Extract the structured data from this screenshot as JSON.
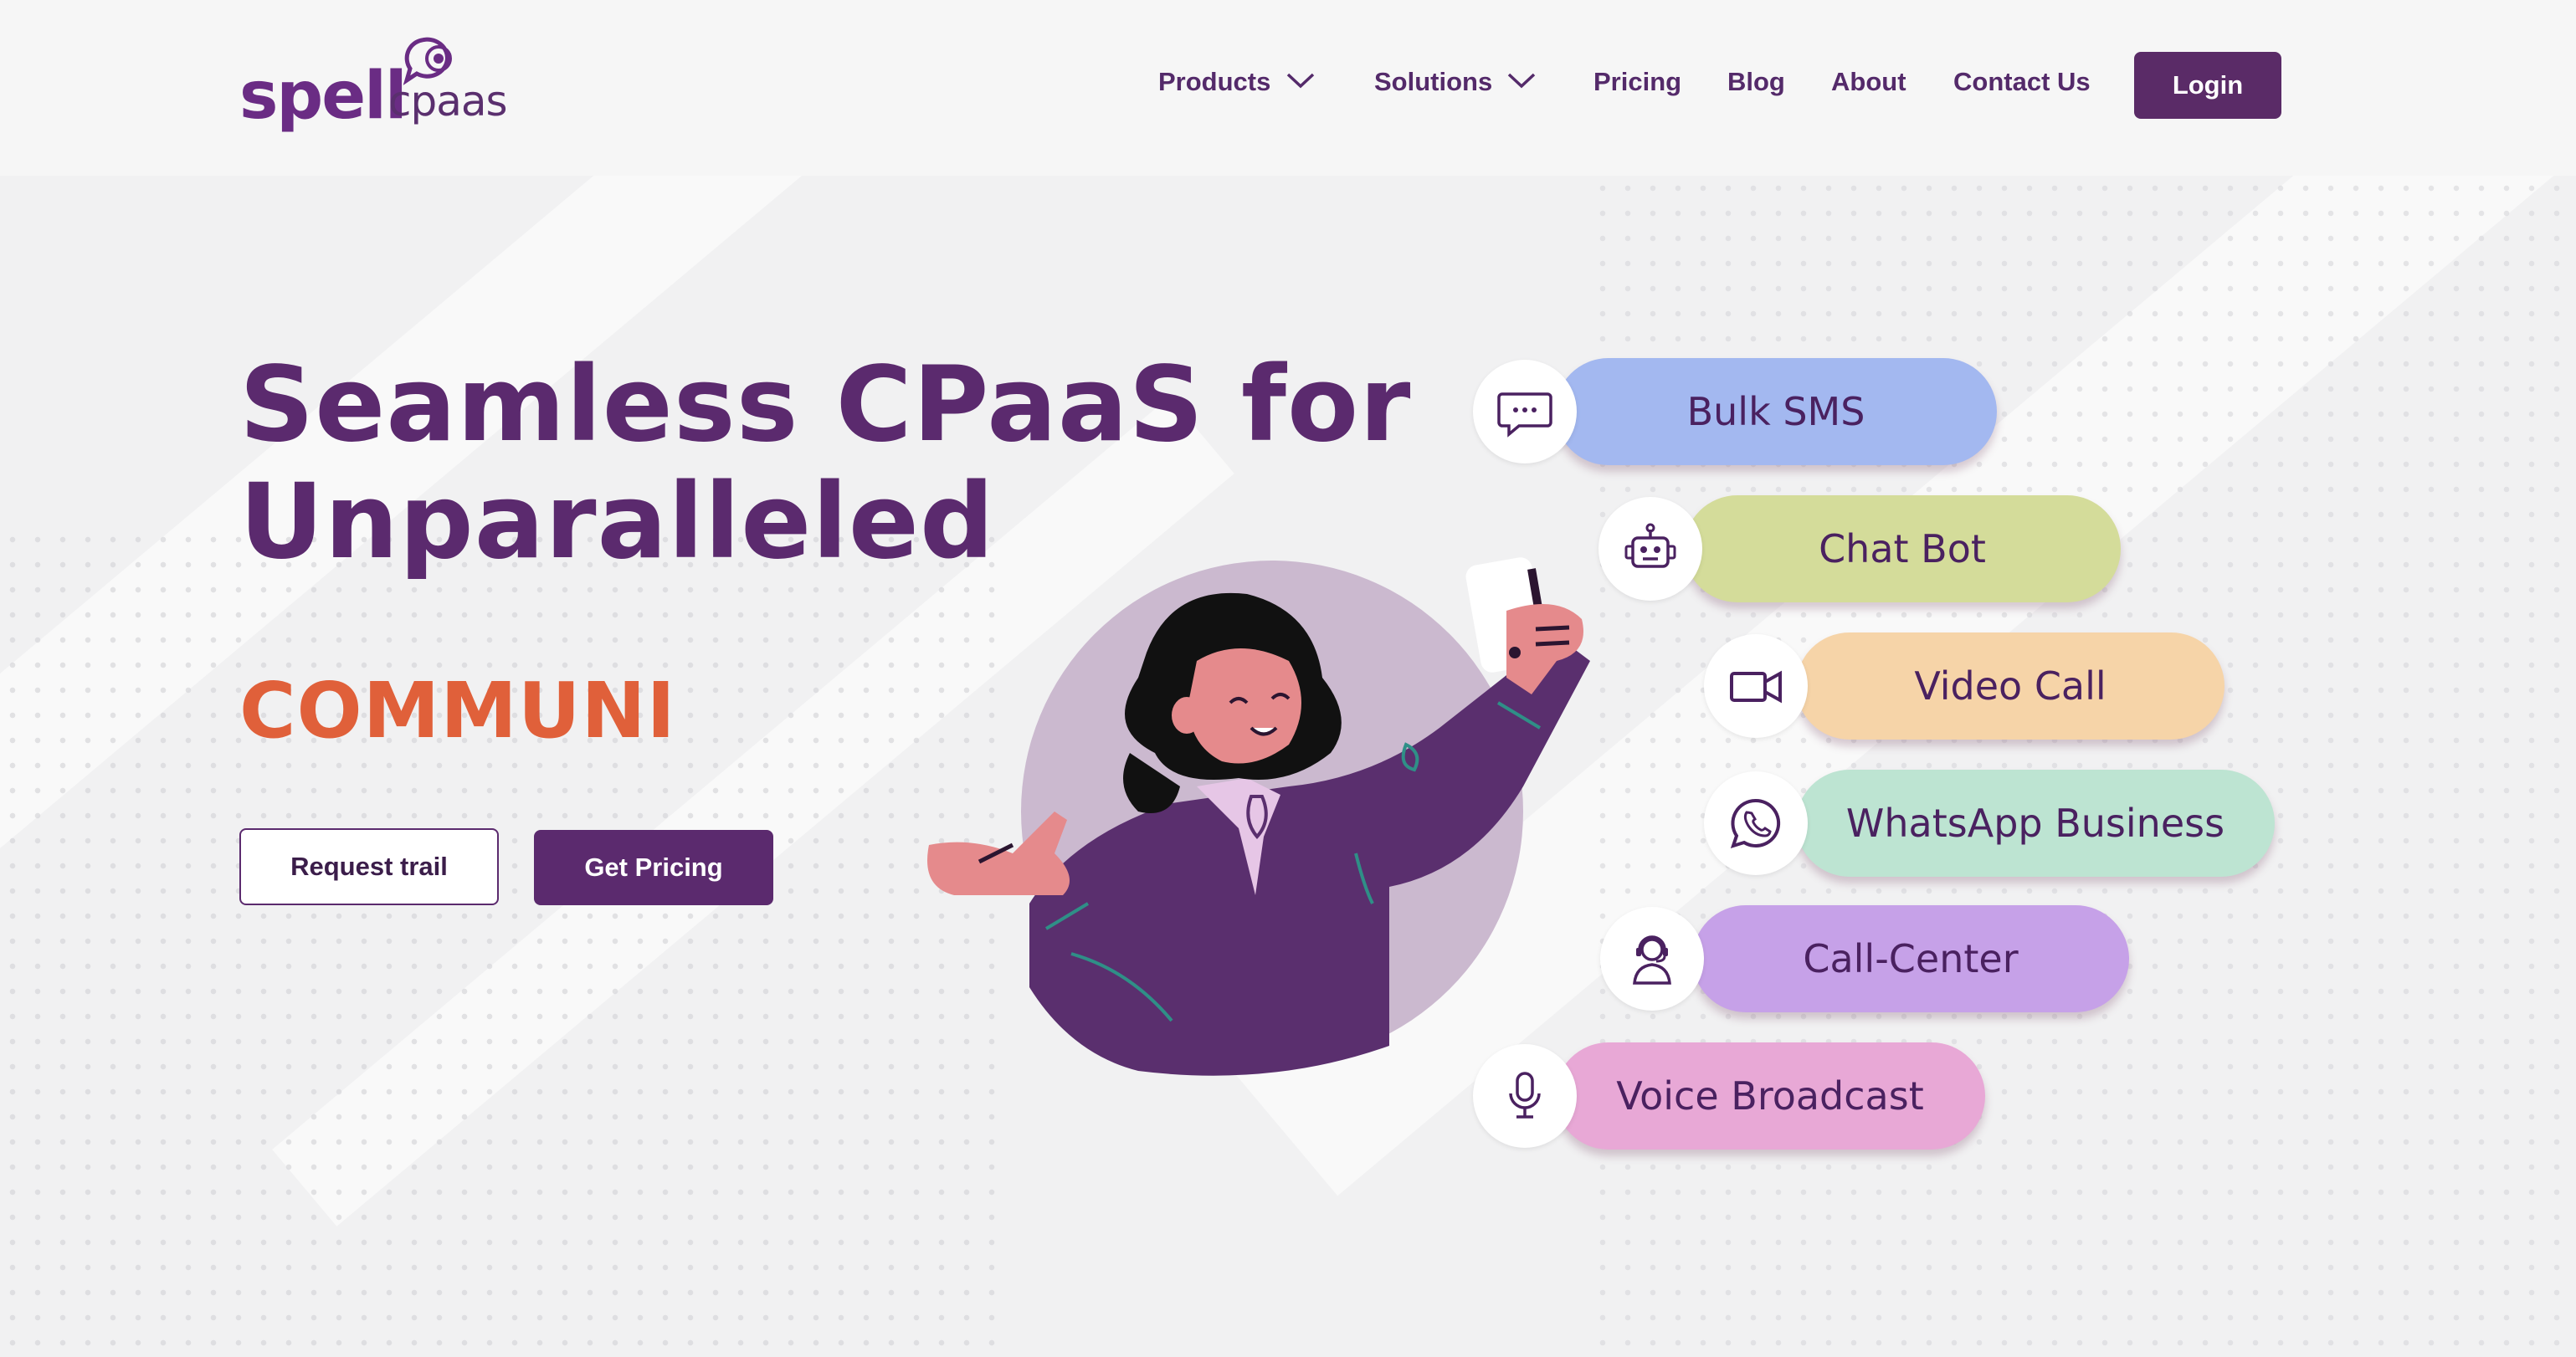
{
  "brand": {
    "logo_primary": "spell",
    "logo_secondary": "cpaas",
    "colors": {
      "primary": "#5b2a6e",
      "accent": "#e0603a"
    }
  },
  "nav": {
    "products": "Products",
    "solutions": "Solutions",
    "pricing": "Pricing",
    "blog": "Blog",
    "about": "About",
    "contact": "Contact Us",
    "login": "Login"
  },
  "hero": {
    "title_line1": "Seamless CPaaS for",
    "title_line2": "Unparalleled",
    "rotating_word": "COMMUNI",
    "request_trial": "Request trail",
    "get_pricing": "Get Pricing"
  },
  "services": [
    {
      "label": "Bulk SMS",
      "icon": "chat-bubble-icon",
      "color": "#a3b8f0"
    },
    {
      "label": "Chat Bot",
      "icon": "robot-icon",
      "color": "#d4dc9a"
    },
    {
      "label": "Video Call",
      "icon": "video-camera-icon",
      "color": "#f6d4a8"
    },
    {
      "label": "WhatsApp Business",
      "icon": "whatsapp-icon",
      "color": "#bde4d2"
    },
    {
      "label": "Call-Center",
      "icon": "headset-agent-icon",
      "color": "#c6a1e8"
    },
    {
      "label": "Voice Broadcast",
      "icon": "microphone-icon",
      "color": "#e8a8d6"
    }
  ]
}
